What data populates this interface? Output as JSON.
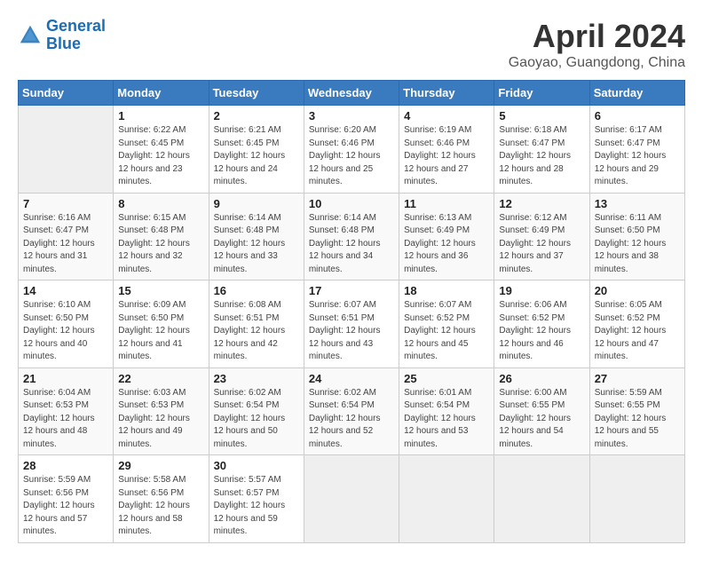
{
  "header": {
    "logo_line1": "General",
    "logo_line2": "Blue",
    "month": "April 2024",
    "location": "Gaoyao, Guangdong, China"
  },
  "weekdays": [
    "Sunday",
    "Monday",
    "Tuesday",
    "Wednesday",
    "Thursday",
    "Friday",
    "Saturday"
  ],
  "weeks": [
    [
      {
        "day": "",
        "empty": true
      },
      {
        "day": "1",
        "sunrise": "6:22 AM",
        "sunset": "6:45 PM",
        "daylight": "12 hours and 23 minutes."
      },
      {
        "day": "2",
        "sunrise": "6:21 AM",
        "sunset": "6:45 PM",
        "daylight": "12 hours and 24 minutes."
      },
      {
        "day": "3",
        "sunrise": "6:20 AM",
        "sunset": "6:46 PM",
        "daylight": "12 hours and 25 minutes."
      },
      {
        "day": "4",
        "sunrise": "6:19 AM",
        "sunset": "6:46 PM",
        "daylight": "12 hours and 27 minutes."
      },
      {
        "day": "5",
        "sunrise": "6:18 AM",
        "sunset": "6:47 PM",
        "daylight": "12 hours and 28 minutes."
      },
      {
        "day": "6",
        "sunrise": "6:17 AM",
        "sunset": "6:47 PM",
        "daylight": "12 hours and 29 minutes."
      }
    ],
    [
      {
        "day": "7",
        "sunrise": "6:16 AM",
        "sunset": "6:47 PM",
        "daylight": "12 hours and 31 minutes."
      },
      {
        "day": "8",
        "sunrise": "6:15 AM",
        "sunset": "6:48 PM",
        "daylight": "12 hours and 32 minutes."
      },
      {
        "day": "9",
        "sunrise": "6:14 AM",
        "sunset": "6:48 PM",
        "daylight": "12 hours and 33 minutes."
      },
      {
        "day": "10",
        "sunrise": "6:14 AM",
        "sunset": "6:48 PM",
        "daylight": "12 hours and 34 minutes."
      },
      {
        "day": "11",
        "sunrise": "6:13 AM",
        "sunset": "6:49 PM",
        "daylight": "12 hours and 36 minutes."
      },
      {
        "day": "12",
        "sunrise": "6:12 AM",
        "sunset": "6:49 PM",
        "daylight": "12 hours and 37 minutes."
      },
      {
        "day": "13",
        "sunrise": "6:11 AM",
        "sunset": "6:50 PM",
        "daylight": "12 hours and 38 minutes."
      }
    ],
    [
      {
        "day": "14",
        "sunrise": "6:10 AM",
        "sunset": "6:50 PM",
        "daylight": "12 hours and 40 minutes."
      },
      {
        "day": "15",
        "sunrise": "6:09 AM",
        "sunset": "6:50 PM",
        "daylight": "12 hours and 41 minutes."
      },
      {
        "day": "16",
        "sunrise": "6:08 AM",
        "sunset": "6:51 PM",
        "daylight": "12 hours and 42 minutes."
      },
      {
        "day": "17",
        "sunrise": "6:07 AM",
        "sunset": "6:51 PM",
        "daylight": "12 hours and 43 minutes."
      },
      {
        "day": "18",
        "sunrise": "6:07 AM",
        "sunset": "6:52 PM",
        "daylight": "12 hours and 45 minutes."
      },
      {
        "day": "19",
        "sunrise": "6:06 AM",
        "sunset": "6:52 PM",
        "daylight": "12 hours and 46 minutes."
      },
      {
        "day": "20",
        "sunrise": "6:05 AM",
        "sunset": "6:52 PM",
        "daylight": "12 hours and 47 minutes."
      }
    ],
    [
      {
        "day": "21",
        "sunrise": "6:04 AM",
        "sunset": "6:53 PM",
        "daylight": "12 hours and 48 minutes."
      },
      {
        "day": "22",
        "sunrise": "6:03 AM",
        "sunset": "6:53 PM",
        "daylight": "12 hours and 49 minutes."
      },
      {
        "day": "23",
        "sunrise": "6:02 AM",
        "sunset": "6:54 PM",
        "daylight": "12 hours and 50 minutes."
      },
      {
        "day": "24",
        "sunrise": "6:02 AM",
        "sunset": "6:54 PM",
        "daylight": "12 hours and 52 minutes."
      },
      {
        "day": "25",
        "sunrise": "6:01 AM",
        "sunset": "6:54 PM",
        "daylight": "12 hours and 53 minutes."
      },
      {
        "day": "26",
        "sunrise": "6:00 AM",
        "sunset": "6:55 PM",
        "daylight": "12 hours and 54 minutes."
      },
      {
        "day": "27",
        "sunrise": "5:59 AM",
        "sunset": "6:55 PM",
        "daylight": "12 hours and 55 minutes."
      }
    ],
    [
      {
        "day": "28",
        "sunrise": "5:59 AM",
        "sunset": "6:56 PM",
        "daylight": "12 hours and 57 minutes."
      },
      {
        "day": "29",
        "sunrise": "5:58 AM",
        "sunset": "6:56 PM",
        "daylight": "12 hours and 58 minutes."
      },
      {
        "day": "30",
        "sunrise": "5:57 AM",
        "sunset": "6:57 PM",
        "daylight": "12 hours and 59 minutes."
      },
      {
        "day": "",
        "empty": true
      },
      {
        "day": "",
        "empty": true
      },
      {
        "day": "",
        "empty": true
      },
      {
        "day": "",
        "empty": true
      }
    ]
  ]
}
